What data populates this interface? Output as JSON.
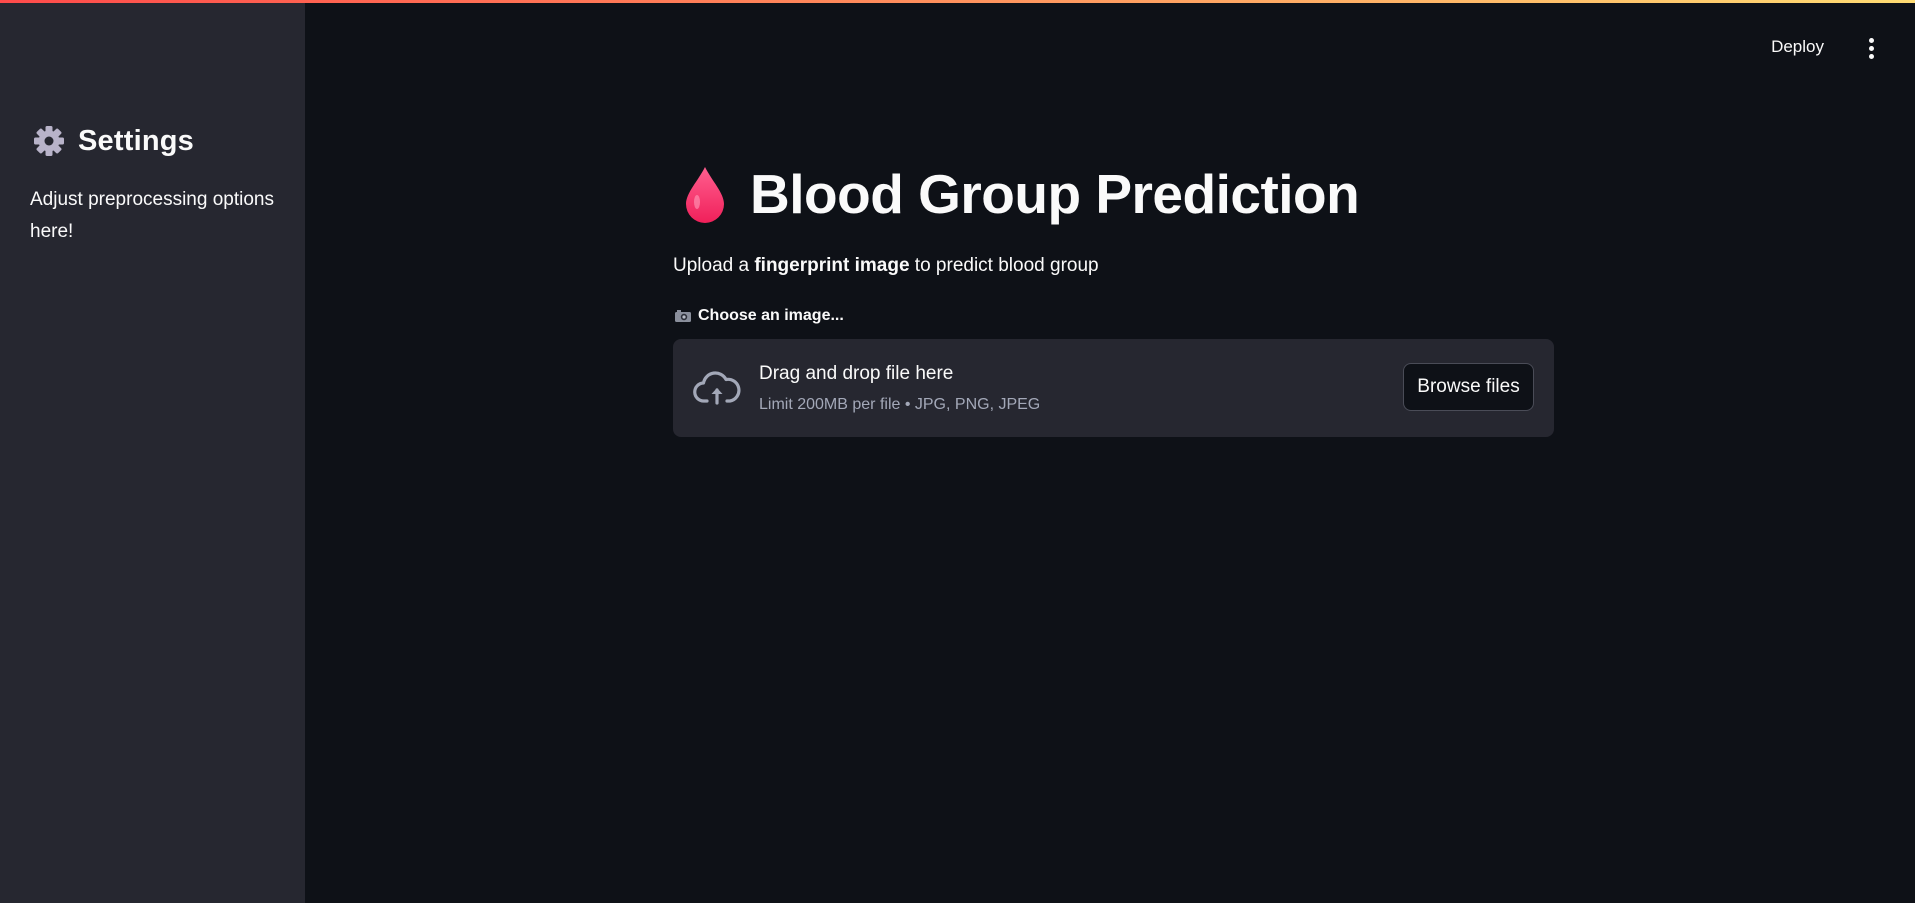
{
  "sidebar": {
    "icon": "gear-icon",
    "title": "Settings",
    "description": "Adjust preprocessing options here!"
  },
  "header": {
    "deploy_label": "Deploy",
    "menu_icon": "vertical-ellipsis-icon"
  },
  "main": {
    "title_icon": "blood-drop-icon",
    "title": "Blood Group Prediction",
    "subtitle": {
      "prefix": "Upload a ",
      "bold": "fingerprint image",
      "suffix": " to predict blood group"
    },
    "uploader": {
      "label_icon": "camera-icon",
      "label": "Choose an image...",
      "drop_title": "Drag and drop file here",
      "drop_limit": "Limit 200MB per file • JPG, PNG, JPEG",
      "browse_label": "Browse files",
      "upload_icon": "cloud-upload-icon"
    }
  },
  "colors": {
    "background": "#0e1117",
    "sidebar": "#262730",
    "text": "#fafafa",
    "muted_text": "#a3a8b8",
    "accent_gradient_start": "#ff4b4b",
    "accent_gradient_end": "#ffdc73",
    "drop_color": "#ff2d6b"
  }
}
